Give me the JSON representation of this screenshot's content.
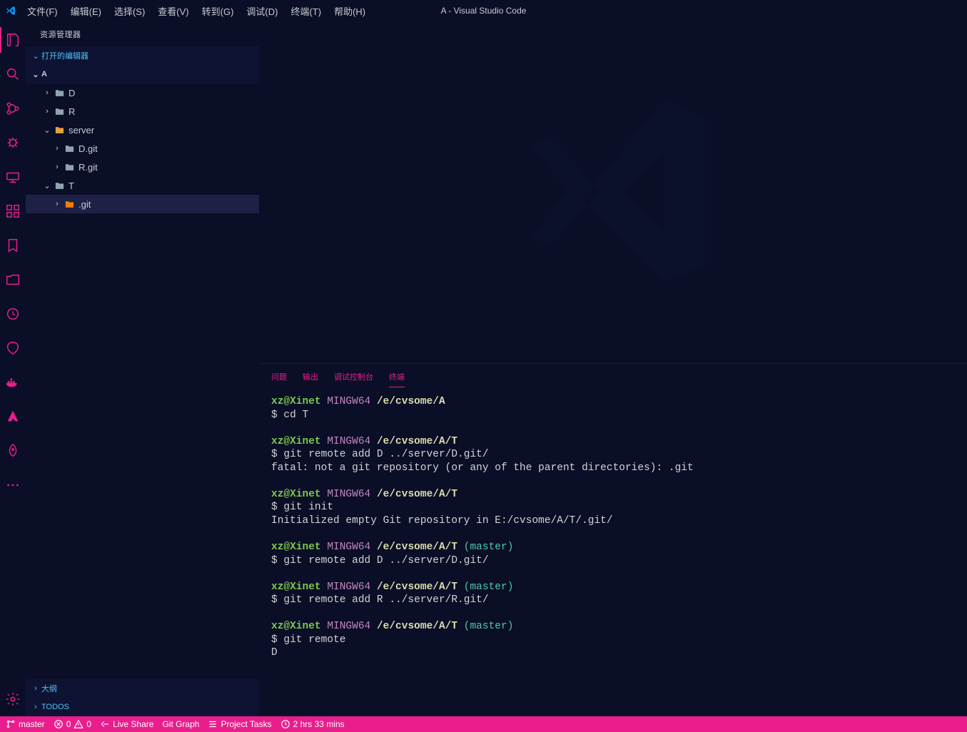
{
  "window": {
    "title": "A - Visual Studio Code"
  },
  "menu": {
    "file": "文件(F)",
    "edit": "编辑(E)",
    "select": "选择(S)",
    "view": "查看(V)",
    "goto": "转到(G)",
    "debug": "调试(D)",
    "terminal": "终端(T)",
    "help": "帮助(H)"
  },
  "sidebar": {
    "title": "资源管理器",
    "open_editors": "打开的编辑器",
    "workspace": "A",
    "outline": "大纲",
    "todos": "TODOS",
    "tree": [
      {
        "label": "D",
        "indent": 1,
        "expanded": false,
        "iconColor": "gray"
      },
      {
        "label": "R",
        "indent": 1,
        "expanded": false,
        "iconColor": "gray"
      },
      {
        "label": "server",
        "indent": 1,
        "expanded": true,
        "iconColor": "gold"
      },
      {
        "label": "D.git",
        "indent": 2,
        "expanded": false,
        "iconColor": "gray"
      },
      {
        "label": "R.git",
        "indent": 2,
        "expanded": false,
        "iconColor": "gray"
      },
      {
        "label": "T",
        "indent": 1,
        "expanded": true,
        "iconColor": "gray"
      },
      {
        "label": ".git",
        "indent": 2,
        "expanded": false,
        "iconColor": "orange",
        "selected": true
      }
    ]
  },
  "panel": {
    "tabs": {
      "problems": "问题",
      "output": "输出",
      "debug_console": "调试控制台",
      "terminal": "终端"
    },
    "active_tab": "terminal"
  },
  "terminal": {
    "prompt_user": "xz@Xinet",
    "prompt_sys": "MINGW64",
    "blocks": [
      {
        "path": "/e/cvsome/A",
        "branch": "",
        "cmd": "cd T",
        "out": []
      },
      {
        "path": "/e/cvsome/A/T",
        "branch": "",
        "cmd": "git remote add D ../server/D.git/",
        "out": [
          "fatal: not a git repository (or any of the parent directories): .git"
        ]
      },
      {
        "path": "/e/cvsome/A/T",
        "branch": "",
        "cmd": "git init",
        "out": [
          "Initialized empty Git repository in E:/cvsome/A/T/.git/"
        ]
      },
      {
        "path": "/e/cvsome/A/T",
        "branch": "(master)",
        "cmd": "git remote add D ../server/D.git/",
        "out": []
      },
      {
        "path": "/e/cvsome/A/T",
        "branch": "(master)",
        "cmd": "git remote add R ../server/R.git/",
        "out": []
      },
      {
        "path": "/e/cvsome/A/T",
        "branch": "(master)",
        "cmd": "git remote",
        "out": [
          "D"
        ]
      }
    ]
  },
  "statusbar": {
    "branch": "master",
    "errors": "0",
    "warnings": "0",
    "liveshare": "Live Share",
    "gitgraph": "Git Graph",
    "project_tasks": "Project Tasks",
    "time": "2 hrs 33 mins"
  }
}
